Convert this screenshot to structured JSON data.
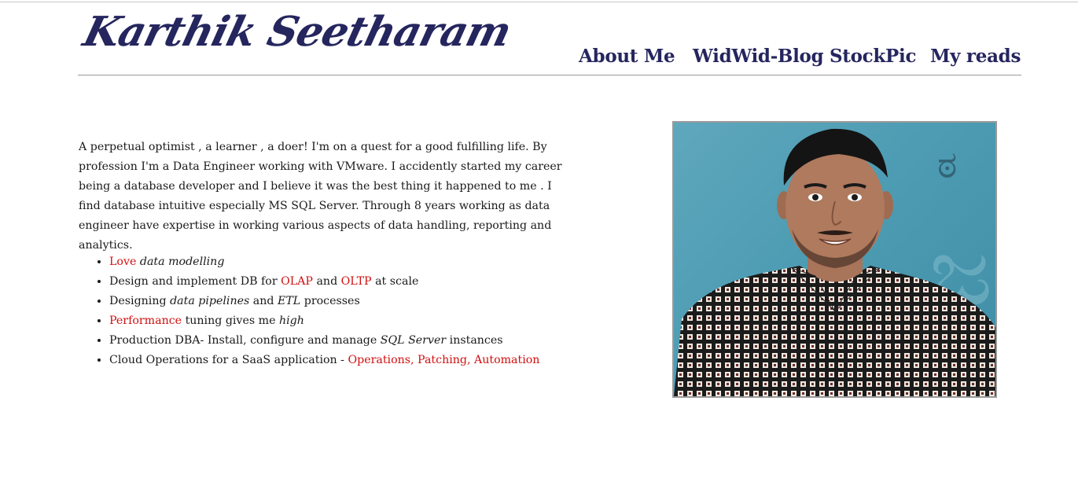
{
  "header": {
    "logo_text": "Karthik Seetharam",
    "nav": [
      "About Me",
      "WidWid-Blog",
      "StockPic",
      "My reads"
    ]
  },
  "intro": {
    "text": "A perpetual optimist , a learner , a doer! I'm on a quest for a good fulfilling life. By profession I'm a Data Engineer working with VMware. I accidently started my career being a database developer and I believe it was the best thing it happened to me . I find database intuitive especially MS SQL Server. Through 8 years working as data engineer have expertise in working various aspects of data handling, reporting and analytics."
  },
  "skills": [
    {
      "parts": [
        {
          "t": "Love",
          "style": "red"
        },
        {
          "t": " "
        },
        {
          "t": "data modelling",
          "style": "em"
        }
      ]
    },
    {
      "parts": [
        {
          "t": "Design and implement DB for "
        },
        {
          "t": "OLAP",
          "style": "red"
        },
        {
          "t": " and "
        },
        {
          "t": "OLTP",
          "style": "red"
        },
        {
          "t": " at scale"
        }
      ]
    },
    {
      "parts": [
        {
          "t": "Designing "
        },
        {
          "t": "data pipelines",
          "style": "em"
        },
        {
          "t": " and "
        },
        {
          "t": "ETL",
          "style": "em"
        },
        {
          "t": " processes"
        }
      ]
    },
    {
      "parts": [
        {
          "t": "Performance",
          "style": "red"
        },
        {
          "t": " tuning gives me "
        },
        {
          "t": "high",
          "style": "em"
        }
      ]
    },
    {
      "parts": [
        {
          "t": "Production DBA- Install, configure and manage "
        },
        {
          "t": "SQL Server",
          "style": "em"
        },
        {
          "t": " instances"
        }
      ]
    },
    {
      "parts": [
        {
          "t": "Cloud Operations for a SaaS application - "
        },
        {
          "t": "Operations, Patching, Automation",
          "style": "red"
        }
      ]
    }
  ],
  "colors": {
    "nav": "#25265e",
    "accent_red": "#d01010",
    "photo_bg": "#4d9cb3",
    "shirt_check": "#1b1b1b"
  },
  "photo": {
    "alt": "profile-photo"
  }
}
